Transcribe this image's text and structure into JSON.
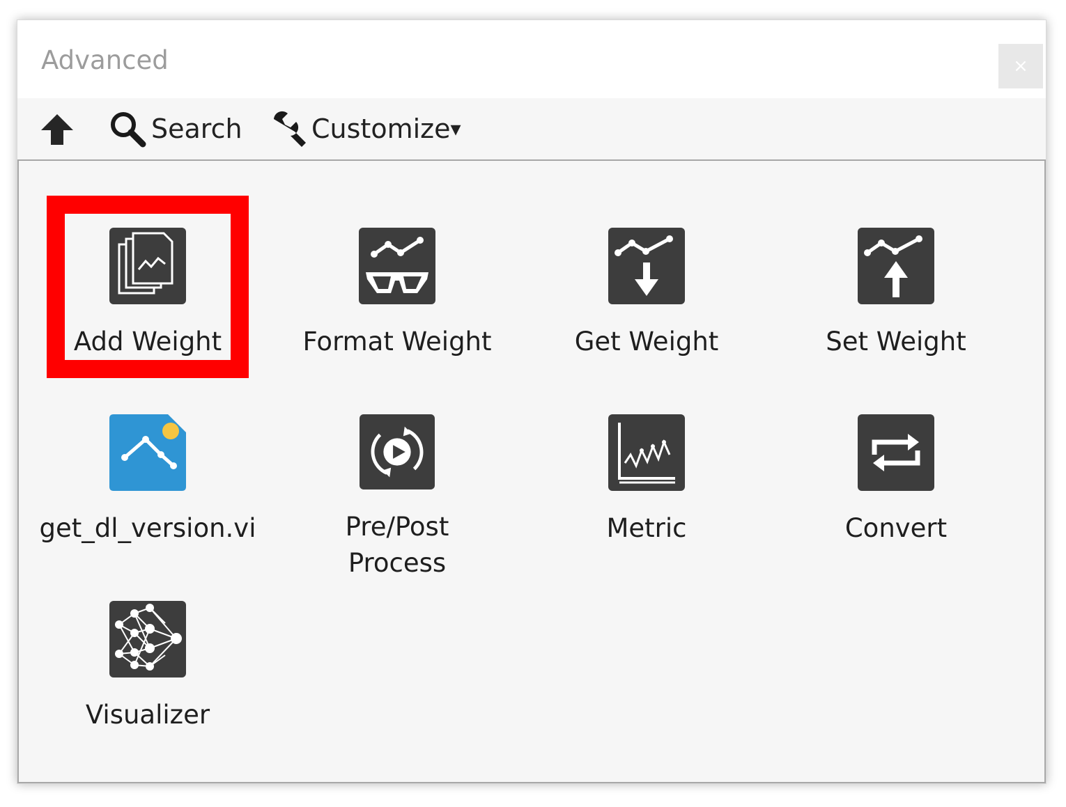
{
  "window": {
    "title": "Advanced",
    "close_label": "×"
  },
  "toolbar": {
    "up_icon": "arrow-up-icon",
    "search_label": "Search",
    "customize_label": "Customize",
    "customize_arrow": "▾"
  },
  "tiles": [
    {
      "label": "Add Weight",
      "icon": "add-weight-icon",
      "selected": true
    },
    {
      "label": "Format Weight",
      "icon": "format-weight-icon"
    },
    {
      "label": "Get Weight",
      "icon": "get-weight-icon"
    },
    {
      "label": "Set Weight",
      "icon": "set-weight-icon"
    },
    {
      "label": "get_dl_version.vi",
      "icon": "get-dl-version-icon"
    },
    {
      "label": "Pre/Post\nProcess",
      "icon": "pre-post-process-icon"
    },
    {
      "label": "Metric",
      "icon": "metric-icon"
    },
    {
      "label": "Convert",
      "icon": "convert-icon"
    },
    {
      "label": "Visualizer",
      "icon": "visualizer-icon"
    }
  ],
  "colors": {
    "icon_dark": "#3d3d3d",
    "icon_blue": "#2f95d4",
    "icon_dot_yellow": "#f5c542",
    "selection_red": "#ff0000"
  }
}
